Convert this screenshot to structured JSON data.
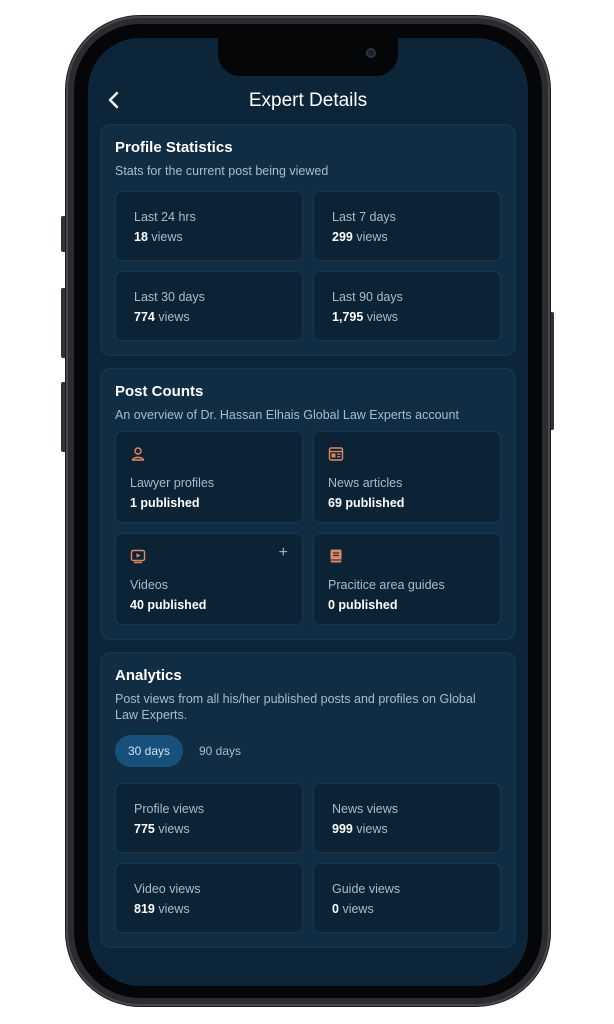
{
  "header": {
    "title": "Expert Details"
  },
  "profile_statistics": {
    "title": "Profile Statistics",
    "subtitle": "Stats for the current post being viewed",
    "cards": [
      {
        "label": "Last 24 hrs",
        "value": "18",
        "unit": "views"
      },
      {
        "label": "Last 7 days",
        "value": "299",
        "unit": "views"
      },
      {
        "label": "Last 30 days",
        "value": "774",
        "unit": "views"
      },
      {
        "label": "Last 90 days",
        "value": "1,795",
        "unit": "views"
      }
    ]
  },
  "post_counts": {
    "title": "Post Counts",
    "subtitle": "An overview of Dr. Hassan Elhais Global Law Experts account",
    "cards": [
      {
        "icon": "user-icon",
        "label": "Lawyer profiles",
        "value": "1 published"
      },
      {
        "icon": "news-icon",
        "label": "News articles",
        "value": "69 published"
      },
      {
        "icon": "video-icon",
        "label": "Videos",
        "value": "40 published",
        "action": "+"
      },
      {
        "icon": "book-icon",
        "label": "Pracitice area guides",
        "value": "0 published"
      }
    ]
  },
  "analytics": {
    "title": "Analytics",
    "subtitle": "Post views from all his/her published posts and profiles on Global Law Experts.",
    "tabs": [
      {
        "label": "30 days",
        "active": true
      },
      {
        "label": "90 days",
        "active": false
      }
    ],
    "cards": [
      {
        "label": "Profile views",
        "value": "775",
        "unit": "views"
      },
      {
        "label": "News views",
        "value": "999",
        "unit": "views"
      },
      {
        "label": "Video views",
        "value": "819",
        "unit": "views"
      },
      {
        "label": "Guide views",
        "value": "0",
        "unit": "views"
      }
    ]
  },
  "colors": {
    "background": "#0c2538",
    "section": "#102d43",
    "card": "#0b2335",
    "accent_icon": "#e2885e",
    "active_tab": "#17507a"
  }
}
